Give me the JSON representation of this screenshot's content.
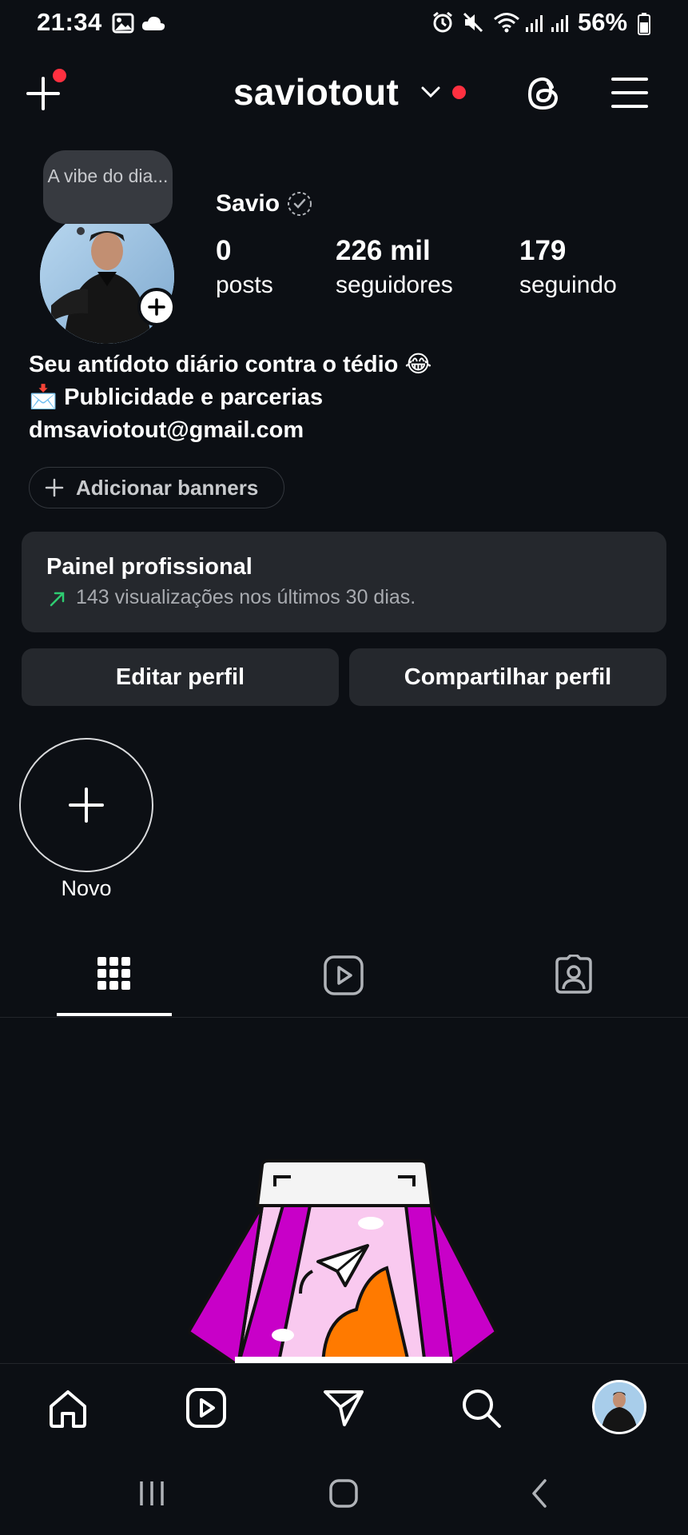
{
  "status_bar": {
    "time": "21:34",
    "battery": "56%",
    "icons_left": [
      "image-icon",
      "cloud-icon"
    ],
    "icons_right": [
      "alarm-icon",
      "mute-icon",
      "wifi-icon",
      "signal-icon",
      "signal-icon",
      "battery-icon"
    ]
  },
  "header": {
    "username": "saviotout",
    "icons": [
      "add-icon",
      "chevron-down-icon",
      "threads-icon",
      "menu-icon"
    ],
    "notification_color": "#ff3040"
  },
  "profile": {
    "note": "A vibe do dia...",
    "name": "Savio",
    "stats": [
      {
        "value": "0",
        "label": "posts"
      },
      {
        "value": "226 mil",
        "label": "seguidores"
      },
      {
        "value": "179",
        "label": "seguindo"
      }
    ],
    "bio": [
      "Seu antídoto diário contra o tédio 😂",
      "📩 Publicidade e parcerias",
      "dmsaviotout@gmail.com"
    ],
    "add_banners": "Adicionar banners"
  },
  "professional_panel": {
    "title": "Painel profissional",
    "subtitle": "143 visualizações nos últimos 30 dias.",
    "trend_color": "#2ecc71"
  },
  "actions": {
    "edit": "Editar perfil",
    "share": "Compartilhar perfil"
  },
  "highlights": {
    "new_label": "Novo"
  },
  "tabs": [
    "grid-icon",
    "reels-icon",
    "tagged-icon"
  ],
  "bottom_nav": [
    "home-icon",
    "reels-icon",
    "direct-icon",
    "search-icon",
    "profile-avatar"
  ]
}
